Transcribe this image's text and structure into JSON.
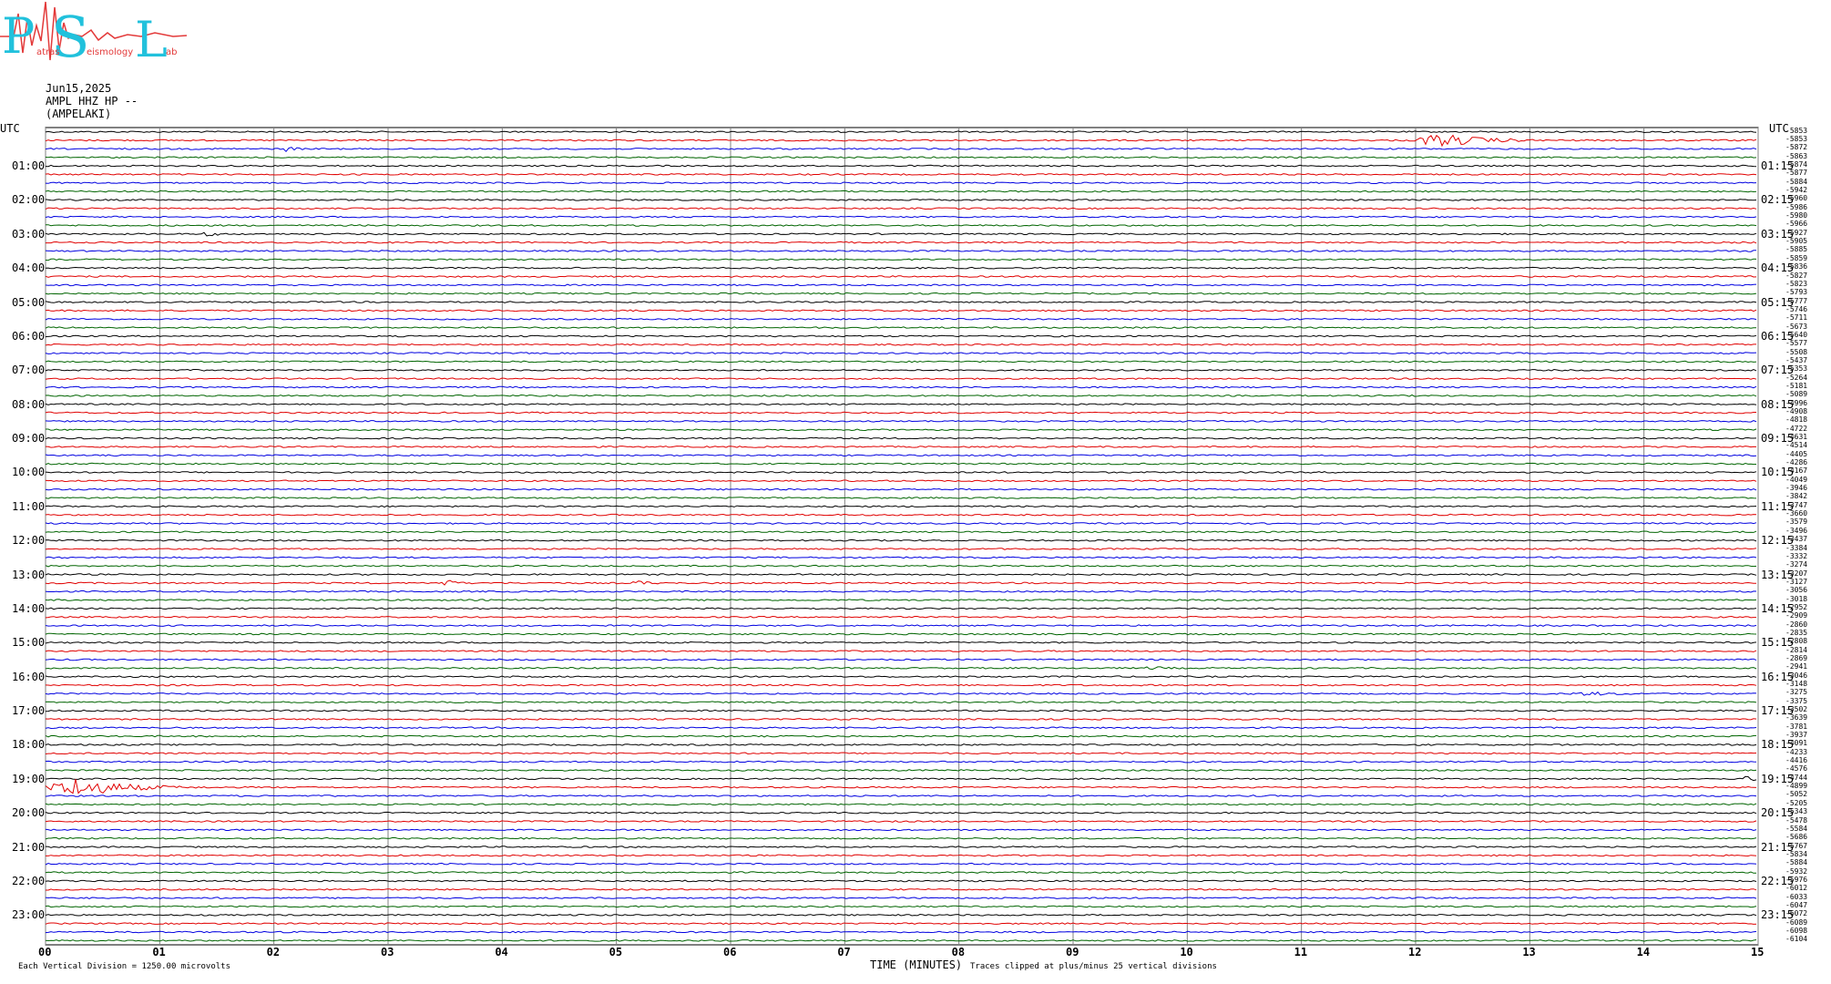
{
  "logo": {
    "letters": [
      "P",
      "S",
      "L"
    ],
    "words": [
      "atras",
      "eismology",
      "ab"
    ],
    "cyan": "#21c1dc",
    "red": "#e33a3a"
  },
  "header": {
    "date": "Jun15,2025",
    "station": "AMPL HHZ HP --",
    "site": "(AMPELAKI)"
  },
  "chart_data": {
    "type": "line",
    "title": "",
    "utc_label": "UTC",
    "xlabel": "TIME (MINUTES)",
    "xlim": [
      0,
      15
    ],
    "x_ticks": [
      "00",
      "01",
      "02",
      "03",
      "04",
      "05",
      "06",
      "07",
      "08",
      "09",
      "10",
      "11",
      "12",
      "13",
      "14",
      "15"
    ],
    "trace_colors": [
      "#000000",
      "#e00000",
      "#0000e0",
      "#006400"
    ],
    "left_hour_labels": [
      "01:00",
      "02:00",
      "03:00",
      "04:00",
      "05:00",
      "06:00",
      "07:00",
      "08:00",
      "09:00",
      "10:00",
      "11:00",
      "12:00",
      "13:00",
      "14:00",
      "15:00",
      "16:00",
      "17:00",
      "18:00",
      "19:00",
      "20:00",
      "21:00",
      "22:00",
      "23:00"
    ],
    "right_hour_labels": [
      "01:15",
      "02:15",
      "03:15",
      "04:15",
      "05:15",
      "06:15",
      "07:15",
      "08:15",
      "09:15",
      "10:15",
      "11:15",
      "12:15",
      "13:15",
      "14:15",
      "15:15",
      "16:15",
      "17:15",
      "18:15",
      "19:15",
      "20:15",
      "21:15",
      "22:15",
      "23:15"
    ],
    "right_values": [
      "-5853",
      "-5853",
      "-5872",
      "-5863",
      "-5874",
      "-5877",
      "-5884",
      "-5942",
      "-5960",
      "-5986",
      "-5980",
      "-5966",
      "-5927",
      "-5905",
      "-5885",
      "-5859",
      "-5836",
      "-5827",
      "-5823",
      "-5793",
      "-5777",
      "-5746",
      "-5711",
      "-5673",
      "-5640",
      "-5577",
      "-5508",
      "-5437",
      "-5353",
      "-5264",
      "-5181",
      "-5089",
      "-4996",
      "-4908",
      "-4818",
      "-4722",
      "-4631",
      "-4514",
      "-4405",
      "-4286",
      "-4167",
      "-4049",
      "-3946",
      "-3842",
      "-3747",
      "-3660",
      "-3579",
      "-3496",
      "-3437",
      "-3384",
      "-3332",
      "-3274",
      "-3207",
      "-3127",
      "-3056",
      "-3018",
      "-2952",
      "-2909",
      "-2860",
      "-2835",
      "-2808",
      "-2814",
      "-2869",
      "-2941",
      "-3046",
      "-3148",
      "-3275",
      "-3375",
      "-3502",
      "-3639",
      "-3781",
      "-3937",
      "-4091",
      "-4233",
      "-4416",
      "-4576",
      "-4744",
      "-4899",
      "-5052",
      "-5205",
      "-5343",
      "-5478",
      "-5584",
      "-5686",
      "-5767",
      "-5834",
      "-5884",
      "-5932",
      "-5976",
      "-6012",
      "-6033",
      "-6047",
      "-6072",
      "-6089",
      "-6098",
      "-6104"
    ],
    "events": [
      {
        "row": 1,
        "minute": 12.2,
        "span": 0.9,
        "amp": 5
      },
      {
        "row": 2,
        "minute": 2.1,
        "span": 0.3,
        "amp": 2
      },
      {
        "row": 12,
        "minute": 1.4,
        "span": 0.5,
        "amp": 1.5
      },
      {
        "row": 53,
        "minute": 3.5,
        "span": 0.3,
        "amp": 2.5
      },
      {
        "row": 53,
        "minute": 5.2,
        "span": 0.3,
        "amp": 2
      },
      {
        "row": 63,
        "minute": 5.5,
        "span": 0.3,
        "amp": 1.5
      },
      {
        "row": 63,
        "minute": 9.7,
        "span": 0.6,
        "amp": 1.2
      },
      {
        "row": 66,
        "minute": 13.5,
        "span": 1.0,
        "amp": 1.4
      },
      {
        "row": 77,
        "minute": 0.25,
        "span": 1.0,
        "amp": 7
      },
      {
        "row": 76,
        "minute": 14.9,
        "span": 0.2,
        "amp": 3
      }
    ],
    "footer_left": "Each Vertical Division = 1250.00 microvolts",
    "footer_right": "Traces clipped at plus/minus 25 vertical divisions"
  }
}
